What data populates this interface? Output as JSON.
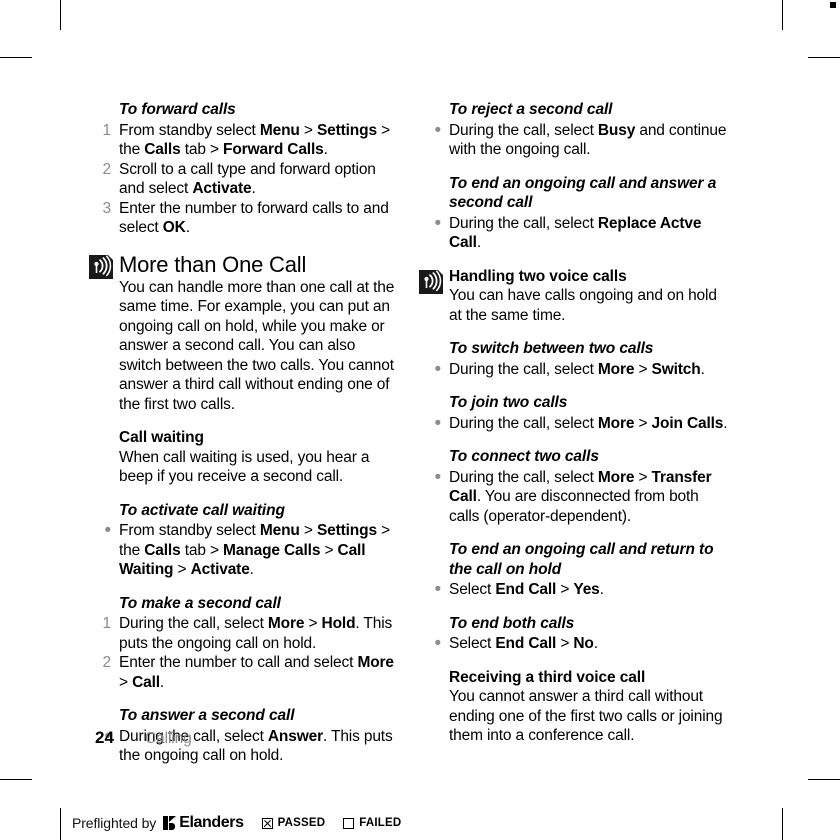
{
  "page": {
    "folio": "24",
    "chapter": "Calling"
  },
  "icons": {
    "note": "broadcast-waves-icon"
  },
  "left_column": [
    {
      "type": "heading-italic",
      "name": "heading-to-forward-calls",
      "text": "To forward calls"
    },
    {
      "type": "ordered-list",
      "name": "list-forward-calls",
      "items": [
        {
          "marker": "1",
          "runs": [
            {
              "t": "From standby select "
            },
            {
              "t": "Menu",
              "b": true
            },
            {
              "t": " > "
            },
            {
              "t": "Settings",
              "b": true
            },
            {
              "t": " > the "
            },
            {
              "t": "Calls",
              "b": true
            },
            {
              "t": " tab > "
            },
            {
              "t": "Forward Calls",
              "b": true
            },
            {
              "t": "."
            }
          ]
        },
        {
          "marker": "2",
          "runs": [
            {
              "t": "Scroll to a call type and forward option and select "
            },
            {
              "t": "Activate",
              "b": true
            },
            {
              "t": "."
            }
          ]
        },
        {
          "marker": "3",
          "runs": [
            {
              "t": "Enter the number to forward calls to and select "
            },
            {
              "t": "OK",
              "b": true
            },
            {
              "t": "."
            }
          ]
        }
      ]
    },
    {
      "type": "section",
      "name": "section-more-than-one-call",
      "icon": "broadcast-waves-icon",
      "heading": "More than One Call",
      "body": "You can handle more than one call at the same time. For example, you can put an ongoing call on hold, while you make or answer a second call. You can also switch between the two calls. You cannot answer a third call without ending one of the first two calls."
    },
    {
      "type": "subsection",
      "name": "subsection-call-waiting",
      "heading": "Call waiting",
      "body": "When call waiting is used, you hear a beep if you receive a second call."
    },
    {
      "type": "heading-italic",
      "name": "heading-to-activate-call-waiting",
      "text": "To activate call waiting"
    },
    {
      "type": "bullet-list",
      "name": "list-activate-call-waiting",
      "items": [
        {
          "marker": "•",
          "runs": [
            {
              "t": "From standby select "
            },
            {
              "t": "Menu",
              "b": true
            },
            {
              "t": " > "
            },
            {
              "t": "Settings",
              "b": true
            },
            {
              "t": " > the "
            },
            {
              "t": "Calls",
              "b": true
            },
            {
              "t": " tab > "
            },
            {
              "t": "Manage Calls",
              "b": true
            },
            {
              "t": " > "
            },
            {
              "t": "Call Waiting",
              "b": true
            },
            {
              "t": " > "
            },
            {
              "t": "Activate",
              "b": true
            },
            {
              "t": "."
            }
          ]
        }
      ]
    },
    {
      "type": "heading-italic",
      "name": "heading-to-make-a-second-call",
      "text": "To make a second call"
    },
    {
      "type": "ordered-list",
      "name": "list-make-second-call",
      "items": [
        {
          "marker": "1",
          "runs": [
            {
              "t": "During the call, select "
            },
            {
              "t": "More",
              "b": true
            },
            {
              "t": " > "
            },
            {
              "t": "Hold",
              "b": true
            },
            {
              "t": ". This puts the ongoing call on hold."
            }
          ]
        },
        {
          "marker": "2",
          "runs": [
            {
              "t": "Enter the number to call and select "
            },
            {
              "t": "More",
              "b": true
            },
            {
              "t": " > "
            },
            {
              "t": "Call",
              "b": true
            },
            {
              "t": "."
            }
          ]
        }
      ]
    },
    {
      "type": "heading-italic",
      "name": "heading-to-answer-a-second-call",
      "text": "To answer a second call"
    },
    {
      "type": "bullet-list",
      "name": "list-answer-second-call",
      "items": [
        {
          "marker": "•",
          "runs": [
            {
              "t": "During the call, select "
            },
            {
              "t": "Answer",
              "b": true
            },
            {
              "t": ". This puts the ongoing call on hold."
            }
          ]
        }
      ]
    }
  ],
  "right_column": [
    {
      "type": "heading-italic",
      "name": "heading-to-reject-a-second-call",
      "text": "To reject a second call"
    },
    {
      "type": "bullet-list",
      "name": "list-reject-second-call",
      "items": [
        {
          "marker": "•",
          "runs": [
            {
              "t": "During the call, select "
            },
            {
              "t": "Busy",
              "b": true
            },
            {
              "t": " and continue with the ongoing call."
            }
          ]
        }
      ]
    },
    {
      "type": "heading-italic",
      "name": "heading-to-end-ongoing-and-answer",
      "text": "To end an ongoing call and answer a second call"
    },
    {
      "type": "bullet-list",
      "name": "list-end-ongoing-and-answer",
      "items": [
        {
          "marker": "•",
          "runs": [
            {
              "t": "During the call, select "
            },
            {
              "t": "Replace Actve Call",
              "b": true
            },
            {
              "t": "."
            }
          ]
        }
      ]
    },
    {
      "type": "section-small",
      "name": "section-handling-two-voice-calls",
      "icon": "broadcast-waves-icon",
      "heading": "Handling two voice calls",
      "body": "You can have calls ongoing and on hold at the same time."
    },
    {
      "type": "heading-italic",
      "name": "heading-to-switch-between-two-calls",
      "text": "To switch between two calls"
    },
    {
      "type": "bullet-list",
      "name": "list-switch-between-two-calls",
      "items": [
        {
          "marker": "•",
          "runs": [
            {
              "t": "During the call, select "
            },
            {
              "t": "More",
              "b": true
            },
            {
              "t": " > "
            },
            {
              "t": "Switch",
              "b": true
            },
            {
              "t": "."
            }
          ]
        }
      ]
    },
    {
      "type": "heading-italic",
      "name": "heading-to-join-two-calls",
      "text": "To join two calls"
    },
    {
      "type": "bullet-list",
      "name": "list-join-two-calls",
      "items": [
        {
          "marker": "•",
          "runs": [
            {
              "t": "During the call, select "
            },
            {
              "t": "More",
              "b": true
            },
            {
              "t": " > "
            },
            {
              "t": "Join Calls",
              "b": true
            },
            {
              "t": "."
            }
          ]
        }
      ]
    },
    {
      "type": "heading-italic",
      "name": "heading-to-connect-two-calls",
      "text": "To connect two calls"
    },
    {
      "type": "bullet-list",
      "name": "list-connect-two-calls",
      "items": [
        {
          "marker": "•",
          "runs": [
            {
              "t": "During the call, select "
            },
            {
              "t": "More",
              "b": true
            },
            {
              "t": " > "
            },
            {
              "t": "Transfer Call",
              "b": true
            },
            {
              "t": ". You are disconnected from both calls (operator-dependent)."
            }
          ]
        }
      ]
    },
    {
      "type": "heading-italic",
      "name": "heading-to-end-ongoing-and-return",
      "text": "To end an ongoing call and return to the call on hold"
    },
    {
      "type": "bullet-list",
      "name": "list-end-ongoing-and-return",
      "items": [
        {
          "marker": "•",
          "runs": [
            {
              "t": "Select "
            },
            {
              "t": "End Call",
              "b": true
            },
            {
              "t": " > "
            },
            {
              "t": "Yes",
              "b": true
            },
            {
              "t": "."
            }
          ]
        }
      ]
    },
    {
      "type": "heading-italic",
      "name": "heading-to-end-both-calls",
      "text": "To end both calls"
    },
    {
      "type": "bullet-list",
      "name": "list-end-both-calls",
      "items": [
        {
          "marker": "•",
          "runs": [
            {
              "t": "Select "
            },
            {
              "t": "End Call",
              "b": true
            },
            {
              "t": " > "
            },
            {
              "t": "No",
              "b": true
            },
            {
              "t": "."
            }
          ]
        }
      ]
    },
    {
      "type": "subsection",
      "name": "subsection-receiving-third-voice-call",
      "heading": "Receiving a third voice call",
      "body": "You cannot answer a third call without ending one of the first two calls or joining them into a conference call."
    }
  ],
  "preflight": {
    "text": "Preflighted by",
    "brand": "Elanders",
    "passed_label": "PASSED",
    "failed_label": "FAILED",
    "passed_checked": true,
    "failed_checked": false
  }
}
